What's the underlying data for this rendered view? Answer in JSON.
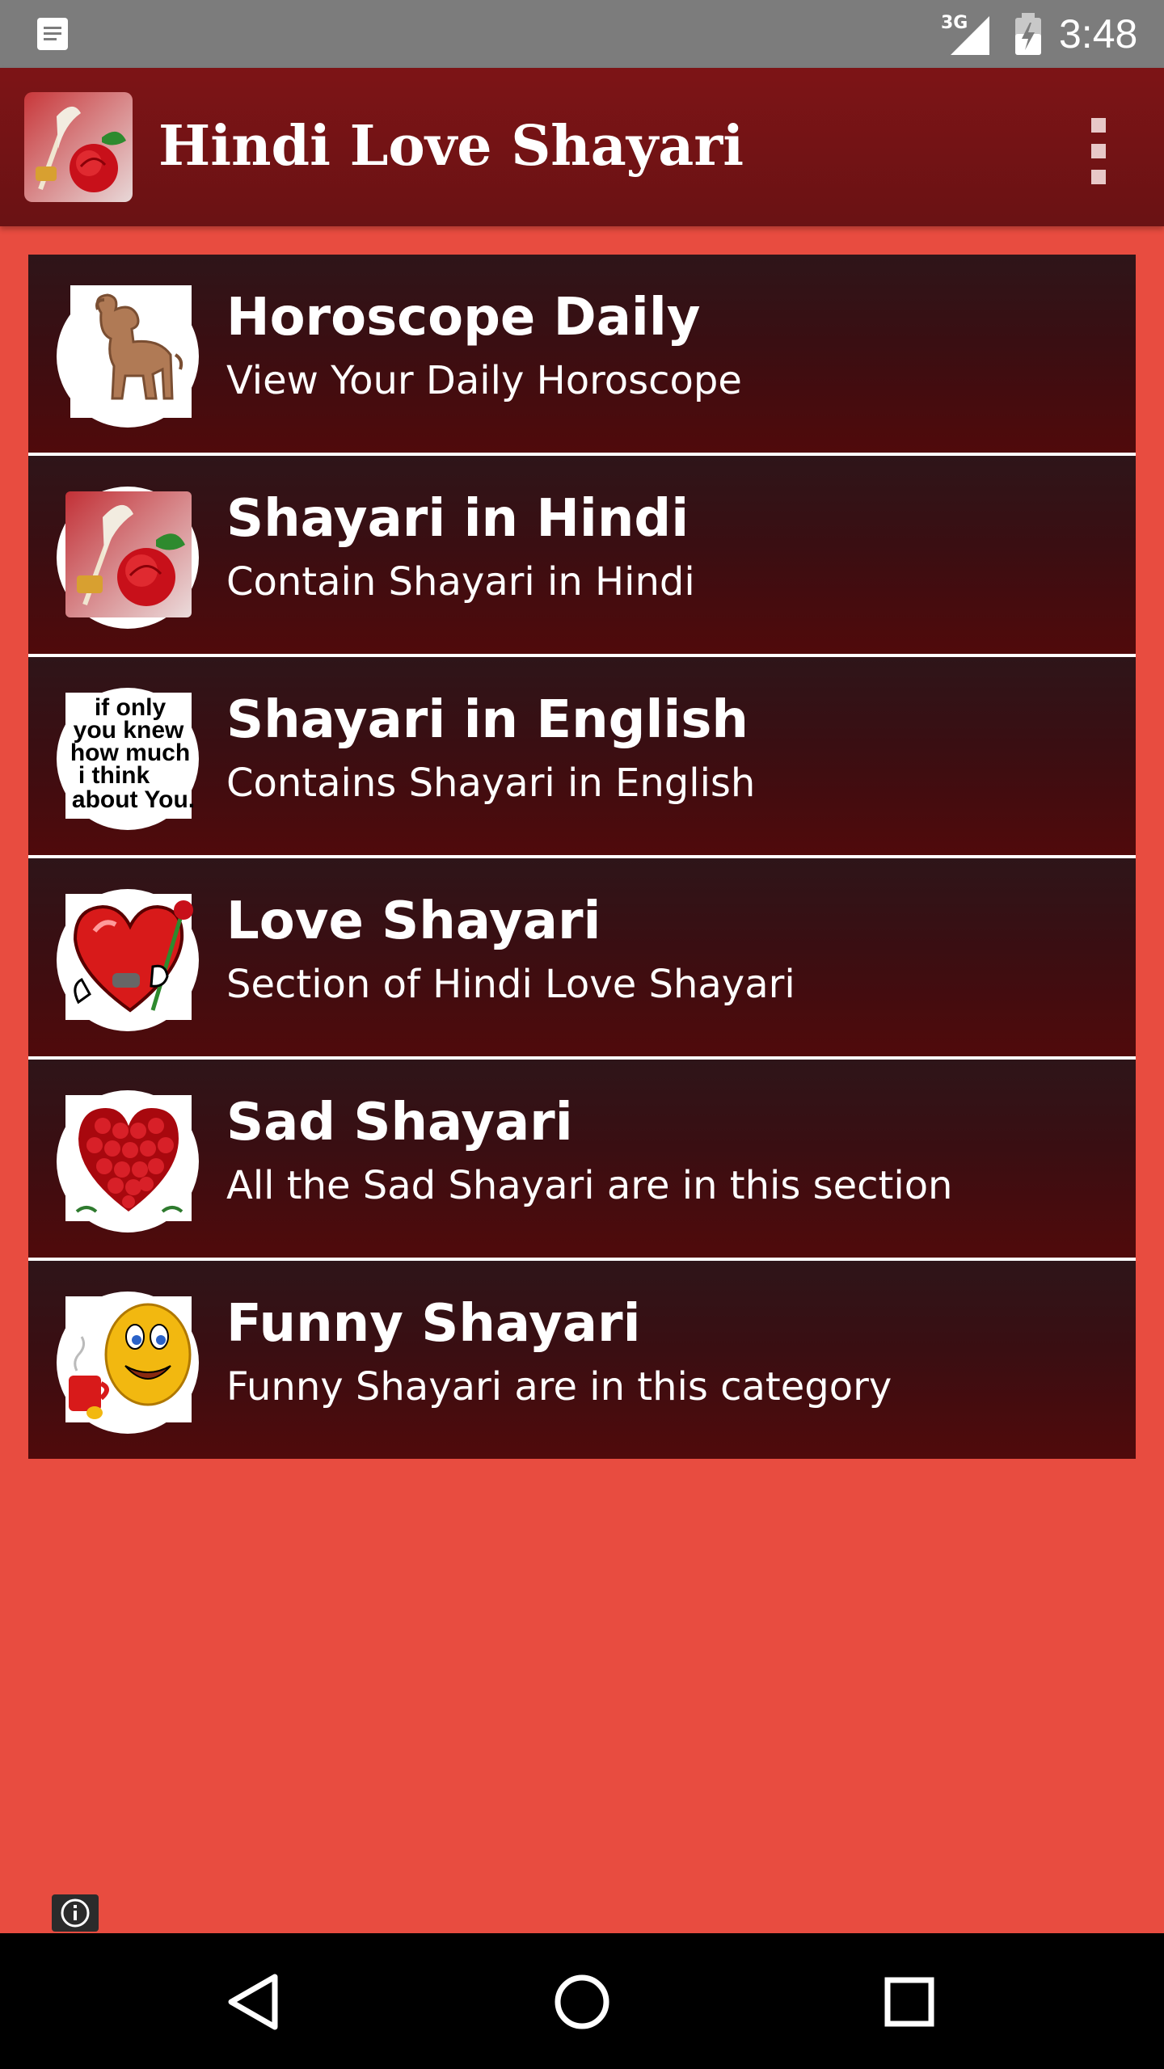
{
  "status_bar": {
    "network": "3G",
    "time": "3:48"
  },
  "app_bar": {
    "title": "Hindi Love Shayari",
    "app_icon": "rose-quill-icon",
    "menu_icon": "overflow-menu-icon"
  },
  "menu": {
    "items": [
      {
        "title": "Horoscope Daily",
        "subtitle": "View Your Daily Horoscope",
        "icon": "aries-ram-icon"
      },
      {
        "title": "Shayari in Hindi",
        "subtitle": "Contain Shayari in Hindi",
        "icon": "rose-quill-icon"
      },
      {
        "title": "Shayari in English",
        "subtitle": "Contains Shayari in English",
        "icon": "quote-text-icon"
      },
      {
        "title": "Love Shayari",
        "subtitle": "Section of Hindi Love Shayari",
        "icon": "heart-with-rose-icon"
      },
      {
        "title": "Sad Shayari",
        "subtitle": "All the Sad Shayari are in this section",
        "icon": "rose-heart-icon"
      },
      {
        "title": "Funny Shayari",
        "subtitle": "Funny Shayari are in this category",
        "icon": "smiley-coffee-icon"
      }
    ]
  },
  "english_icon_text": [
    "if only",
    "you knew",
    "how much",
    "i think",
    "about You."
  ],
  "colors": {
    "background": "#e84c40",
    "app_bar": "#7d1416",
    "item_background": "#3a0e12",
    "status_bar": "#7c7c7c",
    "nav_bar": "#000000"
  },
  "nav_bar": {
    "back_icon": "back-triangle-icon",
    "home_icon": "home-circle-icon",
    "recents_icon": "recents-square-icon"
  }
}
